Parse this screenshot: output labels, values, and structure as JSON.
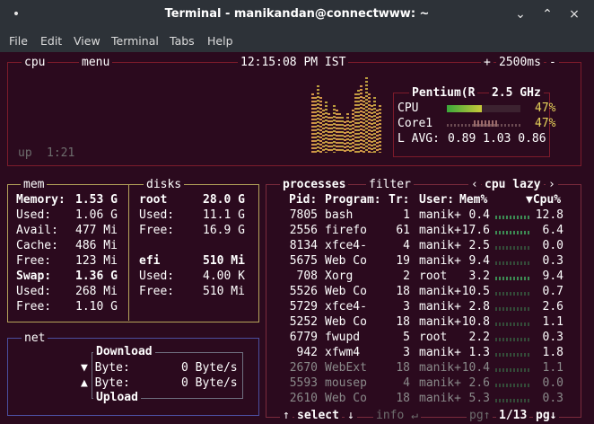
{
  "window": {
    "title": "Terminal - manikandan@connectwww: ~",
    "menu_icon": "•",
    "minimize": "⌄",
    "maximize": "⌃",
    "close": "×"
  },
  "menubar": [
    "File",
    "Edit",
    "View",
    "Terminal",
    "Tabs",
    "Help"
  ],
  "header": {
    "cpu_tab": "cpu",
    "menu_tab": "menu",
    "clock": "12:15:08 PM IST",
    "interval": "2500ms",
    "plus": "+",
    "minus": "-"
  },
  "cpu": {
    "uptime_label": "up",
    "uptime": "1:21",
    "model": "Pentium(R",
    "freq": "2.5 GHz",
    "rows": [
      {
        "label": "CPU",
        "pct": "47%",
        "level": 0.47
      },
      {
        "label": "Core1",
        "pct": "47%",
        "level": 0.47
      }
    ],
    "load_label": "L AVG:",
    "load": "0.89 1.03 0.86"
  },
  "mem": {
    "title": "mem",
    "memory_label": "Memory:",
    "memory_value": "1.53 G",
    "items": [
      {
        "k": "Used:",
        "v": "1.06 G"
      },
      {
        "k": "Avail:",
        "v": "477 Mi"
      },
      {
        "k": "Cache:",
        "v": "486 Mi"
      },
      {
        "k": "Free:",
        "v": "123 Mi"
      }
    ],
    "swap_label": "Swap:",
    "swap_value": "1.36 G",
    "swap_items": [
      {
        "k": "Used:",
        "v": "268 Mi"
      },
      {
        "k": "Free:",
        "v": "1.10 G"
      }
    ]
  },
  "disks": {
    "title": "disks",
    "root": {
      "name": "root",
      "size": "28.0 G",
      "used_k": "Used:",
      "used": "11.1 G",
      "free_k": "Free:",
      "free": "16.9 G"
    },
    "efi": {
      "name": "efi",
      "size": "510 Mi",
      "used_k": "Used:",
      "used": "4.00 K",
      "free_k": "Free:",
      "free": "510 Mi"
    }
  },
  "net": {
    "title": "net",
    "download": "Download",
    "upload": "Upload",
    "down_label": "▼ Byte:",
    "down_value": "0 Byte/s",
    "up_label": "▲ Byte:",
    "up_value": "0 Byte/s"
  },
  "proc": {
    "title": "processes",
    "filter": "filter",
    "sort_left": "‹",
    "sort": "cpu lazy",
    "sort_right": "›",
    "headers": {
      "pid": "Pid:",
      "program": "Program:",
      "tr": "Tr:",
      "user": "User:",
      "mem": "Mem%",
      "cpu": "▼Cpu%"
    },
    "rows": [
      {
        "pid": "7805",
        "prog": "bash",
        "tr": "1",
        "user": "manik+",
        "mem": "0.4",
        "cpu": "12.8"
      },
      {
        "pid": "2556",
        "prog": "firefo",
        "tr": "61",
        "user": "manik+",
        "mem": "17.6",
        "cpu": "6.4"
      },
      {
        "pid": "8134",
        "prog": "xfce4-",
        "tr": "4",
        "user": "manik+",
        "mem": "2.5",
        "cpu": "0.0"
      },
      {
        "pid": "5675",
        "prog": "Web Co",
        "tr": "19",
        "user": "manik+",
        "mem": "9.4",
        "cpu": "0.3"
      },
      {
        "pid": "708",
        "prog": "Xorg",
        "tr": "2",
        "user": "root",
        "mem": "3.2",
        "cpu": "9.4"
      },
      {
        "pid": "5526",
        "prog": "Web Co",
        "tr": "18",
        "user": "manik+",
        "mem": "10.5",
        "cpu": "0.7"
      },
      {
        "pid": "5729",
        "prog": "xfce4-",
        "tr": "3",
        "user": "manik+",
        "mem": "2.8",
        "cpu": "2.6"
      },
      {
        "pid": "5252",
        "prog": "Web Co",
        "tr": "18",
        "user": "manik+",
        "mem": "10.8",
        "cpu": "1.1"
      },
      {
        "pid": "6779",
        "prog": "fwupd",
        "tr": "5",
        "user": "root",
        "mem": "2.2",
        "cpu": "0.3"
      },
      {
        "pid": "942",
        "prog": "xfwm4",
        "tr": "3",
        "user": "manik+",
        "mem": "1.3",
        "cpu": "1.8"
      },
      {
        "pid": "2670",
        "prog": "WebExt",
        "tr": "18",
        "user": "manik+",
        "mem": "10.4",
        "cpu": "1.1"
      },
      {
        "pid": "5593",
        "prog": "mousep",
        "tr": "4",
        "user": "manik+",
        "mem": "2.6",
        "cpu": "0.0"
      },
      {
        "pid": "2610",
        "prog": "Web Co",
        "tr": "18",
        "user": "manik+",
        "mem": "5.3",
        "cpu": "0.3"
      }
    ],
    "footer": {
      "up": "↑",
      "select": "select",
      "down": "↓",
      "info": "info ↵",
      "pg": "pg↑",
      "count": "1/13",
      "pgdn": "pg↓"
    }
  },
  "colors": {
    "background": "#2b0a1e",
    "cpu_border": "#7d1b2b",
    "mem_border": "#b5a35a",
    "net_border": "#4b4e9e",
    "proc_border": "#7a2b3c"
  }
}
